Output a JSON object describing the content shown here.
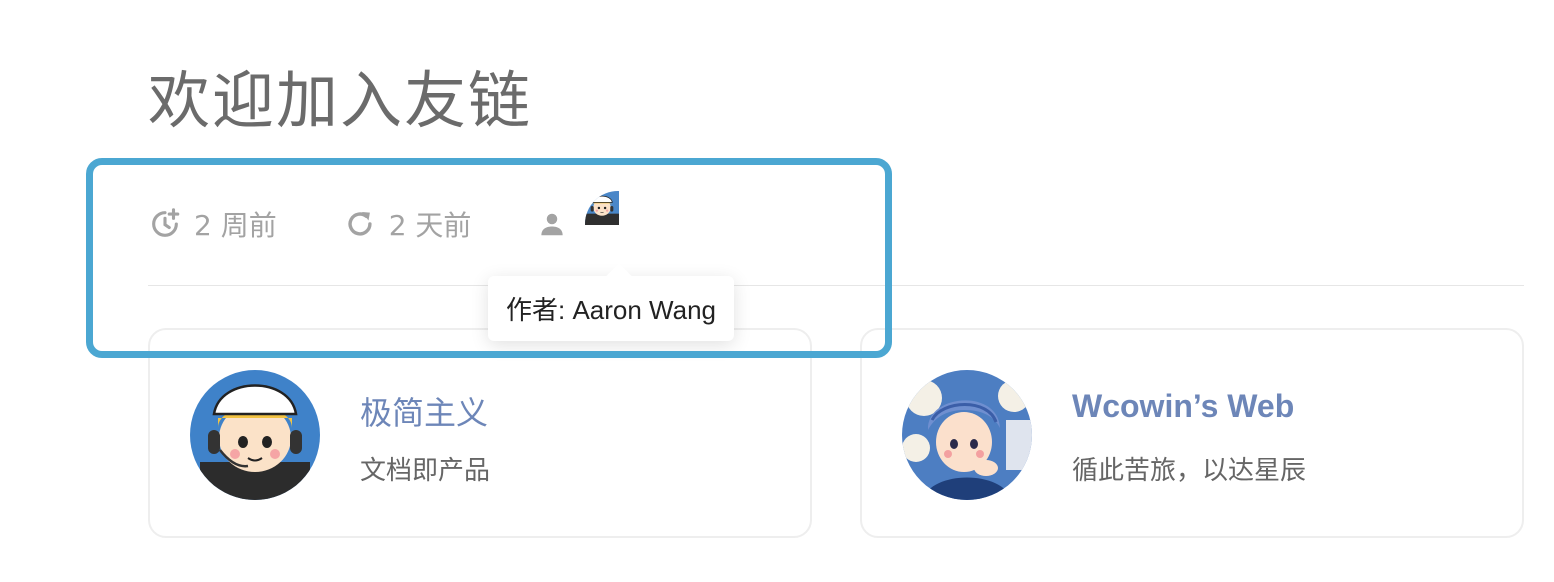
{
  "page": {
    "title": "欢迎加入友链"
  },
  "meta": {
    "created": "2 周前",
    "updated": "2 天前",
    "author_tooltip": "作者: Aaron Wang"
  },
  "cards": [
    {
      "name": "极简主义",
      "description": "文档即产品"
    },
    {
      "name": "Wcowin’s Web",
      "description": "循此苦旅，以达星辰"
    }
  ],
  "colors": {
    "title": "#6b6b6b",
    "meta_text": "#a3a3a3",
    "link": "#6d86b8",
    "highlight": "#4ba7d2"
  },
  "icons": {
    "created": "clock-plus-icon",
    "updated": "refresh-icon",
    "author": "person-icon"
  }
}
